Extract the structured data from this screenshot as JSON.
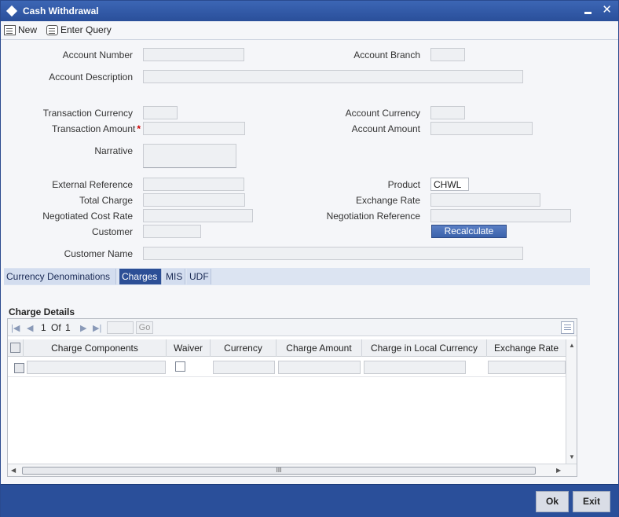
{
  "window": {
    "title": "Cash Withdrawal",
    "close_glyph": "✕"
  },
  "toolbar": {
    "new_label": "New",
    "enter_query_label": "Enter Query"
  },
  "form": {
    "account_number": {
      "label": "Account Number",
      "value": ""
    },
    "account_branch": {
      "label": "Account Branch",
      "value": ""
    },
    "account_description": {
      "label": "Account Description",
      "value": ""
    },
    "transaction_currency": {
      "label": "Transaction Currency",
      "value": ""
    },
    "account_currency": {
      "label": "Account Currency",
      "value": ""
    },
    "transaction_amount": {
      "label": "Transaction Amount",
      "required_marker": "*",
      "value": ""
    },
    "account_amount": {
      "label": "Account Amount",
      "value": ""
    },
    "narrative": {
      "label": "Narrative",
      "value": ""
    },
    "external_reference": {
      "label": "External Reference",
      "value": ""
    },
    "product": {
      "label": "Product",
      "value": "CHWL"
    },
    "total_charge": {
      "label": "Total Charge",
      "value": ""
    },
    "exchange_rate": {
      "label": "Exchange Rate",
      "value": ""
    },
    "negotiated_cost_rate": {
      "label": "Negotiated Cost Rate",
      "value": ""
    },
    "negotiation_reference": {
      "label": "Negotiation Reference",
      "value": ""
    },
    "customer": {
      "label": "Customer",
      "value": ""
    },
    "recalculate_label": "Recalculate",
    "customer_name": {
      "label": "Customer Name",
      "value": ""
    }
  },
  "tabs": [
    {
      "label": "Currency Denominations",
      "active": false
    },
    {
      "label": "Charges",
      "active": true
    },
    {
      "label": "MIS",
      "active": false
    },
    {
      "label": "UDF",
      "active": false
    }
  ],
  "charges": {
    "section_title": "Charge Details",
    "pager": {
      "current": "1",
      "of_label": "Of",
      "total": "1",
      "go_label": "Go"
    },
    "columns": [
      "Charge Components",
      "Waiver",
      "Currency",
      "Charge Amount",
      "Charge in Local Currency",
      "Exchange Rate"
    ],
    "scroll_thumb_glyph": "III"
  },
  "footer": {
    "ok_label": "Ok",
    "exit_label": "Exit"
  },
  "colors": {
    "titlebar": "#2a4f9a",
    "active_tab": "#2c4f96",
    "required": "#cc0000"
  }
}
